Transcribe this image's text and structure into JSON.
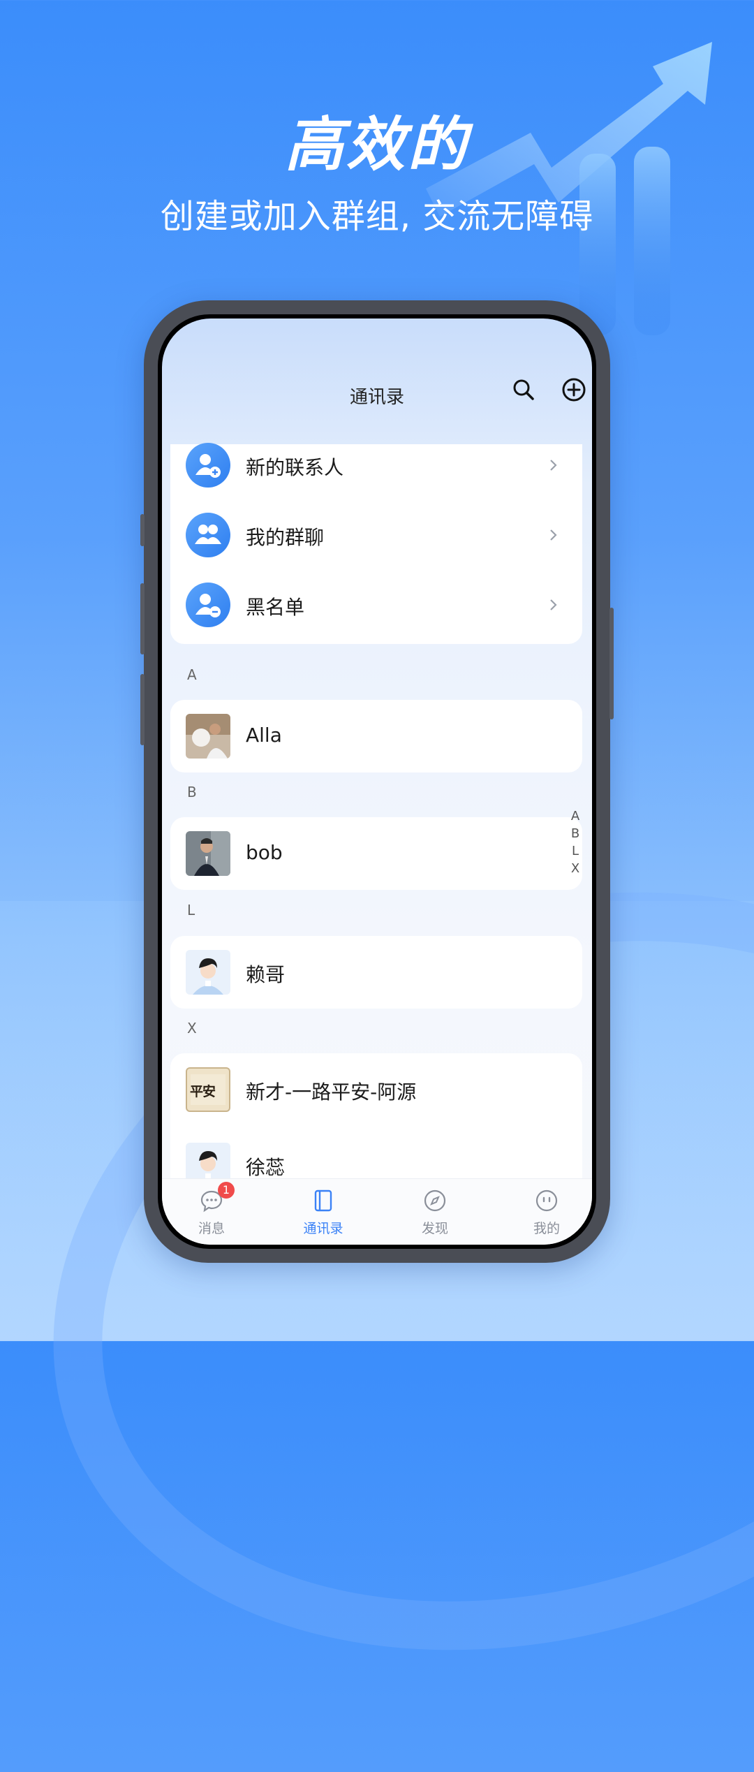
{
  "promo": {
    "headline": "高效的",
    "subhead": "创建或加入群组, 交流无障碍"
  },
  "nav": {
    "title": "通讯录",
    "search_icon": "search-icon",
    "add_icon": "plus-circle-icon"
  },
  "quick_entries": [
    {
      "label": "新的联系人",
      "icon": "add-contact-icon"
    },
    {
      "label": "我的群聊",
      "icon": "group-icon"
    },
    {
      "label": "黑名单",
      "icon": "blocked-user-icon"
    }
  ],
  "sections": [
    {
      "letter": "A",
      "contacts": [
        {
          "name": "Alla"
        }
      ]
    },
    {
      "letter": "B",
      "contacts": [
        {
          "name": "bob"
        }
      ]
    },
    {
      "letter": "L",
      "contacts": [
        {
          "name": "赖哥"
        }
      ]
    },
    {
      "letter": "X",
      "contacts": [
        {
          "name": "新才-一路平安-阿源",
          "avatar_text": "平安"
        },
        {
          "name": "徐蕊"
        }
      ]
    }
  ],
  "index_bar": [
    "A",
    "B",
    "L",
    "X"
  ],
  "tabbar": [
    {
      "label": "消息",
      "icon": "message-icon",
      "badge": "1"
    },
    {
      "label": "通讯录",
      "icon": "contacts-book-icon",
      "active": true
    },
    {
      "label": "发现",
      "icon": "compass-icon"
    },
    {
      "label": "我的",
      "icon": "profile-face-icon"
    }
  ],
  "colors": {
    "accent": "#3b82f6",
    "badge": "#f04b4b",
    "background_top": "#3b8dfb"
  }
}
